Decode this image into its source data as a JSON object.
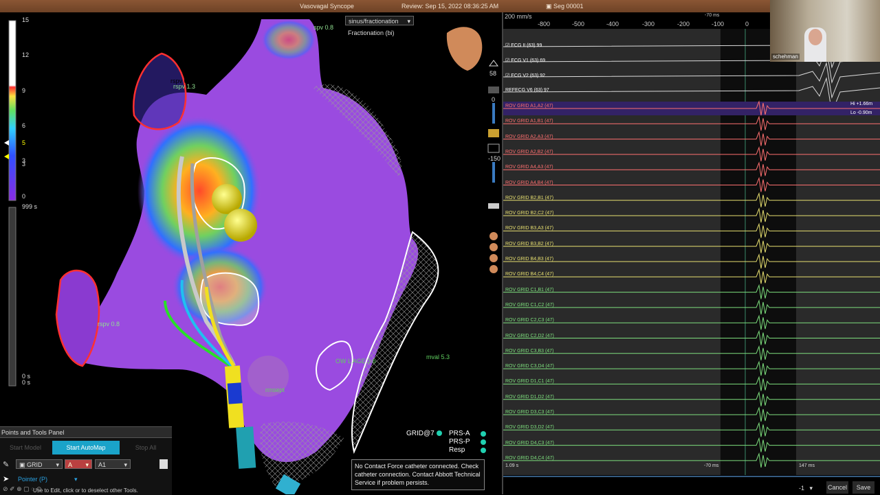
{
  "header": {
    "title": "Vasovagal Syncope",
    "review": "Review: Sep 15, 2022 08:36:25 AM",
    "segment": "Seg 00001"
  },
  "map": {
    "map_type": "sinus/fractionation",
    "subtitle": "Fractionation (bi)",
    "scale_ticks": [
      "15",
      "12",
      "9",
      "6",
      "5",
      "3",
      "3",
      "0"
    ],
    "scale_time": "999 s",
    "bottom_time_1": "0 s",
    "bottom_time_2": "0 s",
    "labels": {
      "rspv_1": "rspv 0.8",
      "rspv_2": "rspv 1.3",
      "rspv_3": "rspv 0.8",
      "lspv": "spv 0.8",
      "mval": "mval 5.3",
      "loc": "OW L AGE 3.6",
      "septal": "rrnsept"
    },
    "right_icons": {
      "n1": "58",
      "n2": "0",
      "n3": "-150"
    }
  },
  "signals": {
    "speed": "200 mm/s",
    "axis": [
      "-800",
      "-500",
      "-400",
      "-300",
      "-200",
      "-100",
      "0"
    ],
    "marker_top": "-70 ms",
    "hi": "Hi +1.66m",
    "lo": "Lo -0.90m",
    "time_left": "1.09 s",
    "marker_1": "-70 ms",
    "marker_2": "147 ms",
    "ecg_channels": [
      {
        "label": "ECG II (63)",
        "value": "99"
      },
      {
        "label": "ECG V1 (63)",
        "value": "69"
      },
      {
        "label": "ECG V2 (63)",
        "value": "92"
      },
      {
        "label": "ECG V6 (63)",
        "value": "97"
      }
    ],
    "ecg_ref": "REF",
    "channels": [
      "ROV GRID A1,A2 (47)",
      "ROV GRID A1,B1 (47)",
      "ROV GRID A2,A3 (47)",
      "ROV GRID A2,B2 (47)",
      "ROV GRID A4,A3 (47)",
      "ROV GRID A4,B4 (47)",
      "ROV GRID B2,B1 (47)",
      "ROV GRID B2,C2 (47)",
      "ROV GRID B3,A3 (47)",
      "ROV GRID B3,B2 (47)",
      "ROV GRID B4,B3 (47)",
      "ROV GRID B4,C4 (47)",
      "ROV GRID C1,B1 (47)",
      "ROV GRID C1,C2 (47)",
      "ROV GRID C2,C3 (47)",
      "ROV GRID C2,D2 (47)",
      "ROV GRID C3,B3 (47)",
      "ROV GRID C3,D4 (47)",
      "ROV GRID D1,C1 (47)",
      "ROV GRID D1,D2 (47)",
      "ROV GRID D3,C3 (47)",
      "ROV GRID D3,D2 (47)",
      "ROV GRID D4,C3 (47)",
      "ROV GRID D4,C4 (47)"
    ],
    "channel_colors": [
      "#ff7070",
      "#ff7070",
      "#ff7070",
      "#ff7070",
      "#ff7070",
      "#ff7070",
      "#e8e070",
      "#e8e070",
      "#e8e070",
      "#e8e070",
      "#e8e070",
      "#e8e070",
      "#7ee07e",
      "#7ee07e",
      "#7ee07e",
      "#7ee07e",
      "#7ee07e",
      "#7ee07e",
      "#7ee07e",
      "#7ee07e",
      "#7ee07e",
      "#7ee07e",
      "#7ee07e",
      "#7ee07e"
    ],
    "footer_select": "-1",
    "cancel": "Cancel",
    "save": "Save"
  },
  "panel": {
    "title": "Points and Tools Panel",
    "start_model": "Start Model",
    "start_automap": "Start AutoMap",
    "stop_all": "Stop All",
    "catheter": "GRID",
    "letter": "A",
    "electrode": "A1",
    "tool": "Pointer (P)",
    "hint": "Use to Edit, click or to deselect other Tools."
  },
  "legend": {
    "catheter": "GRID@7",
    "items": [
      "PRS-A",
      "PRS-P",
      "Resp"
    ]
  },
  "message": "No Contact Force catheter connected. Check catheter connection. Contact Abbott Technical Service if problem persists.",
  "video": {
    "name": "schehman"
  },
  "colors": {
    "map_purple": "#9a4be0",
    "accent_button": "#1aa3c9",
    "legend_dot": "#20d0b0",
    "lesion": "#e6d400"
  }
}
